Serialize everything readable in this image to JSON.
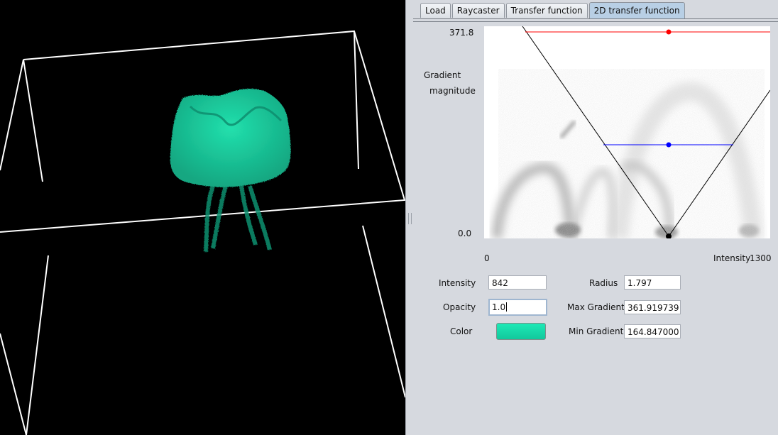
{
  "tabs": [
    {
      "label": "Load",
      "active": false
    },
    {
      "label": "Raycaster",
      "active": false
    },
    {
      "label": "Transfer function",
      "active": false
    },
    {
      "label": "2D transfer function",
      "active": true
    }
  ],
  "plot": {
    "y_max_label": "371.8",
    "y_min_label": "0.0",
    "y_axis_label_line1": "Gradient",
    "y_axis_label_line2": "magnitude",
    "x_min_label": "0",
    "x_axis_label": "Intensity",
    "x_max_label": "1300",
    "colors": {
      "triangle": "#000000",
      "max_gradient_line": "#ff0000",
      "min_gradient_line": "#0000ff",
      "apex_point": "#000000"
    }
  },
  "controls": {
    "intensity_label": "Intensity",
    "intensity_value": "842",
    "opacity_label": "Opacity",
    "opacity_value": "1.0",
    "color_label": "Color",
    "color_value": "#1de9b6",
    "radius_label": "Radius",
    "radius_value": "1.797",
    "max_gradient_label": "Max Gradient",
    "max_gradient_value": "361.919739",
    "min_gradient_label": "Min Gradient",
    "min_gradient_value": "164.847000"
  },
  "render": {
    "background": "#000000",
    "volume_color": "#1de9b6",
    "bounding_box_color": "#ffffff"
  }
}
